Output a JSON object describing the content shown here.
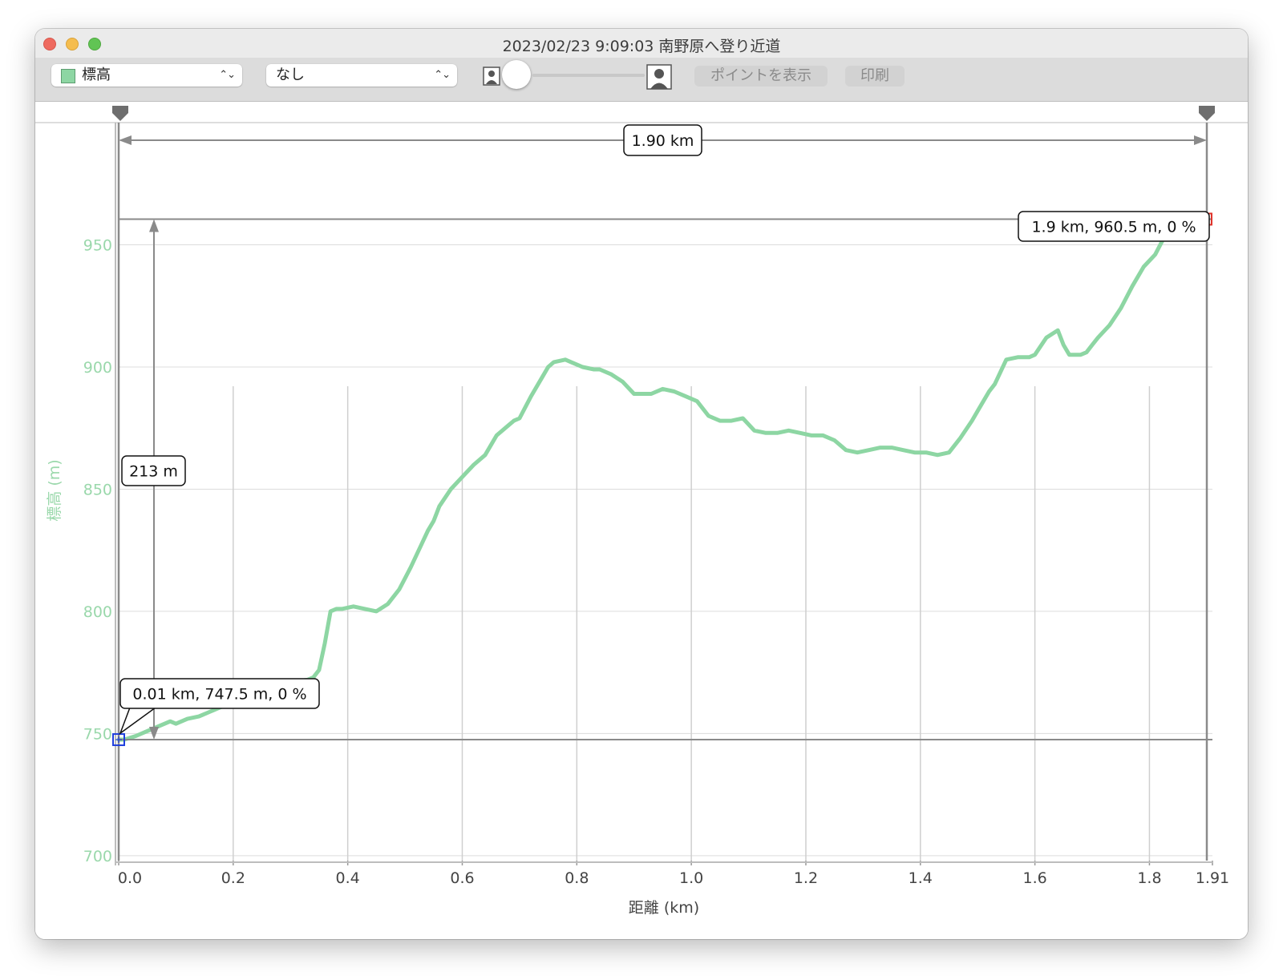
{
  "window": {
    "title": "2023/02/23 9:09:03 南野原へ登り近道"
  },
  "toolbar": {
    "series_select": "標高",
    "series_color": "#8dd6a3",
    "secondary_select": "なし",
    "chevrons": "⌃⌄",
    "show_points_label": "ポイントを表示",
    "print_label": "印刷"
  },
  "measure": {
    "distance_label": "1.90 km",
    "height_label": "213 m",
    "start_point_label": "0.01 km, 747.5 m, 0 %",
    "end_point_label": "1.9 km, 960.5 m, 0 %"
  },
  "chart_data": {
    "type": "area",
    "xlabel": "距離 (km)",
    "ylabel": "標高 (m)",
    "xlim": [
      0.0,
      1.91
    ],
    "ylim": [
      698,
      1000
    ],
    "x_ticks": [
      "0.0",
      "0.2",
      "0.4",
      "0.6",
      "0.8",
      "1.0",
      "1.2",
      "1.4",
      "1.6",
      "1.8",
      "1.91"
    ],
    "x_tick_values": [
      0.0,
      0.2,
      0.4,
      0.6,
      0.8,
      1.0,
      1.2,
      1.4,
      1.6,
      1.8,
      1.91
    ],
    "y_ticks": [
      "700",
      "750",
      "800",
      "850",
      "900",
      "950"
    ],
    "y_tick_values": [
      700,
      750,
      800,
      850,
      900,
      950
    ],
    "grid": true,
    "line_color": "#8dd6a3",
    "series": [
      {
        "x": [
          0.0,
          0.01,
          0.03,
          0.06,
          0.09,
          0.1,
          0.12,
          0.14,
          0.16,
          0.18,
          0.2,
          0.22,
          0.26,
          0.3,
          0.33,
          0.34,
          0.35,
          0.36,
          0.37,
          0.38,
          0.39,
          0.41,
          0.43,
          0.45,
          0.47,
          0.49,
          0.51,
          0.53,
          0.54,
          0.55,
          0.56,
          0.58,
          0.6,
          0.62,
          0.64,
          0.66,
          0.68,
          0.69,
          0.7,
          0.72,
          0.74,
          0.75,
          0.76,
          0.78,
          0.79,
          0.8,
          0.81,
          0.83,
          0.84,
          0.86,
          0.88,
          0.9,
          0.93,
          0.95,
          0.97,
          0.99,
          1.01,
          1.03,
          1.05,
          1.07,
          1.09,
          1.11,
          1.13,
          1.15,
          1.17,
          1.19,
          1.21,
          1.23,
          1.25,
          1.27,
          1.29,
          1.31,
          1.33,
          1.35,
          1.37,
          1.39,
          1.41,
          1.43,
          1.45,
          1.47,
          1.49,
          1.5,
          1.51,
          1.52,
          1.53,
          1.55,
          1.57,
          1.59,
          1.6,
          1.62,
          1.64,
          1.65,
          1.66,
          1.68,
          1.69,
          1.7,
          1.71,
          1.73,
          1.75,
          1.77,
          1.79,
          1.81,
          1.83,
          1.85,
          1.87,
          1.88,
          1.9
        ],
        "y": [
          747.5,
          747.5,
          749,
          752,
          755,
          754,
          756,
          757,
          759,
          761,
          763,
          765,
          768,
          771,
          772,
          773,
          776,
          787,
          800,
          801,
          801,
          802,
          801,
          800,
          803,
          809,
          818,
          828,
          833,
          837,
          843,
          850,
          855,
          860,
          864,
          872,
          876,
          878,
          879,
          888,
          896,
          900,
          902,
          903,
          902,
          901,
          900,
          899,
          899,
          897,
          894,
          889,
          889,
          891,
          890,
          888,
          886,
          880,
          878,
          878,
          879,
          874,
          873,
          873,
          874,
          873,
          872,
          872,
          870,
          866,
          865,
          866,
          867,
          867,
          866,
          865,
          865,
          864,
          865,
          871,
          878,
          882,
          886,
          890,
          893,
          903,
          904,
          904,
          905,
          912,
          915,
          909,
          905,
          905,
          906,
          909,
          912,
          917,
          924,
          933,
          941,
          946,
          955,
          959,
          960.5,
          960.5,
          960.5
        ]
      }
    ]
  }
}
